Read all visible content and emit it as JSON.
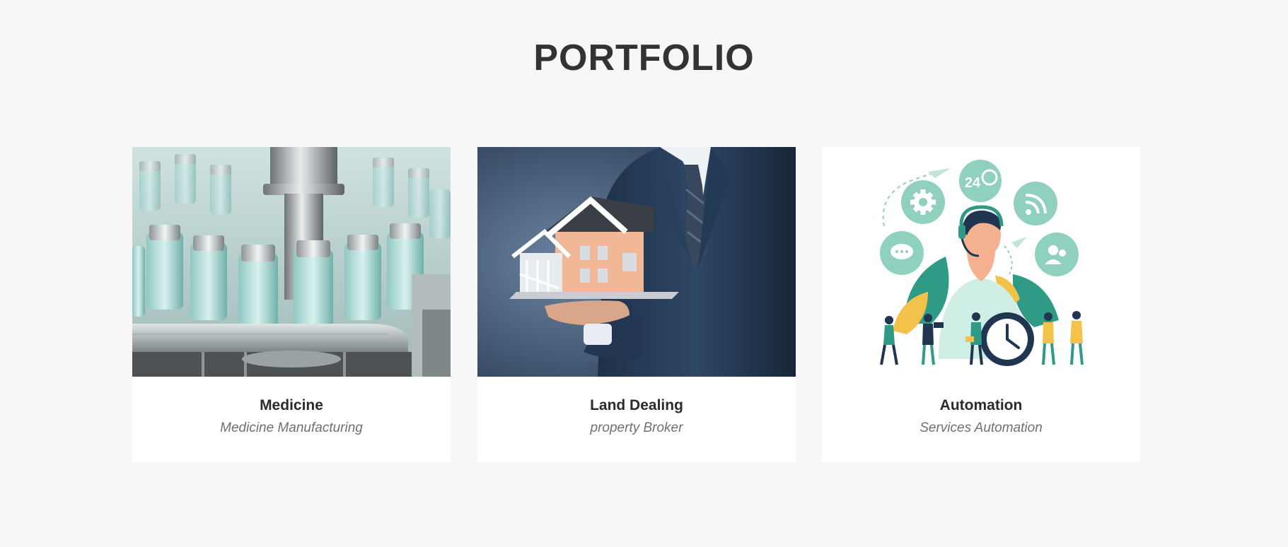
{
  "section": {
    "title": "PORTFOLIO"
  },
  "portfolio": {
    "items": [
      {
        "title": "Medicine",
        "subtitle": "Medicine Manufacturing",
        "image": "medicine-vials-photo"
      },
      {
        "title": "Land Dealing",
        "subtitle": "property Broker",
        "image": "businessman-house-model-photo"
      },
      {
        "title": "Automation",
        "subtitle": "Services Automation",
        "image": "customer-support-automation-illustration"
      }
    ]
  },
  "illustration": {
    "badge_24": "24"
  },
  "colors": {
    "background": "#f7f7f7",
    "card": "#ffffff",
    "title": "#333333",
    "subtitle": "#707070",
    "teal_accent": "#8fd0be",
    "suit_navy": "#1f3550"
  }
}
